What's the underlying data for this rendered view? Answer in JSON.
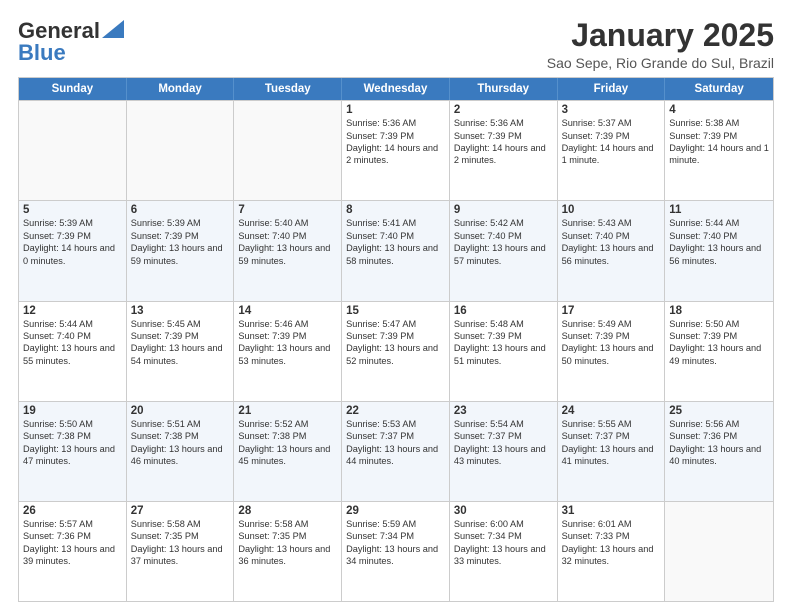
{
  "header": {
    "logo_line1": "General",
    "logo_line2": "Blue",
    "month": "January 2025",
    "location": "Sao Sepe, Rio Grande do Sul, Brazil"
  },
  "weekdays": [
    "Sunday",
    "Monday",
    "Tuesday",
    "Wednesday",
    "Thursday",
    "Friday",
    "Saturday"
  ],
  "rows": [
    [
      {
        "day": "",
        "info": "",
        "empty": true
      },
      {
        "day": "",
        "info": "",
        "empty": true
      },
      {
        "day": "",
        "info": "",
        "empty": true
      },
      {
        "day": "1",
        "info": "Sunrise: 5:36 AM\nSunset: 7:39 PM\nDaylight: 14 hours and 2 minutes."
      },
      {
        "day": "2",
        "info": "Sunrise: 5:36 AM\nSunset: 7:39 PM\nDaylight: 14 hours and 2 minutes."
      },
      {
        "day": "3",
        "info": "Sunrise: 5:37 AM\nSunset: 7:39 PM\nDaylight: 14 hours and 1 minute."
      },
      {
        "day": "4",
        "info": "Sunrise: 5:38 AM\nSunset: 7:39 PM\nDaylight: 14 hours and 1 minute."
      }
    ],
    [
      {
        "day": "5",
        "info": "Sunrise: 5:39 AM\nSunset: 7:39 PM\nDaylight: 14 hours and 0 minutes."
      },
      {
        "day": "6",
        "info": "Sunrise: 5:39 AM\nSunset: 7:39 PM\nDaylight: 13 hours and 59 minutes."
      },
      {
        "day": "7",
        "info": "Sunrise: 5:40 AM\nSunset: 7:40 PM\nDaylight: 13 hours and 59 minutes."
      },
      {
        "day": "8",
        "info": "Sunrise: 5:41 AM\nSunset: 7:40 PM\nDaylight: 13 hours and 58 minutes."
      },
      {
        "day": "9",
        "info": "Sunrise: 5:42 AM\nSunset: 7:40 PM\nDaylight: 13 hours and 57 minutes."
      },
      {
        "day": "10",
        "info": "Sunrise: 5:43 AM\nSunset: 7:40 PM\nDaylight: 13 hours and 56 minutes."
      },
      {
        "day": "11",
        "info": "Sunrise: 5:44 AM\nSunset: 7:40 PM\nDaylight: 13 hours and 56 minutes."
      }
    ],
    [
      {
        "day": "12",
        "info": "Sunrise: 5:44 AM\nSunset: 7:40 PM\nDaylight: 13 hours and 55 minutes."
      },
      {
        "day": "13",
        "info": "Sunrise: 5:45 AM\nSunset: 7:39 PM\nDaylight: 13 hours and 54 minutes."
      },
      {
        "day": "14",
        "info": "Sunrise: 5:46 AM\nSunset: 7:39 PM\nDaylight: 13 hours and 53 minutes."
      },
      {
        "day": "15",
        "info": "Sunrise: 5:47 AM\nSunset: 7:39 PM\nDaylight: 13 hours and 52 minutes."
      },
      {
        "day": "16",
        "info": "Sunrise: 5:48 AM\nSunset: 7:39 PM\nDaylight: 13 hours and 51 minutes."
      },
      {
        "day": "17",
        "info": "Sunrise: 5:49 AM\nSunset: 7:39 PM\nDaylight: 13 hours and 50 minutes."
      },
      {
        "day": "18",
        "info": "Sunrise: 5:50 AM\nSunset: 7:39 PM\nDaylight: 13 hours and 49 minutes."
      }
    ],
    [
      {
        "day": "19",
        "info": "Sunrise: 5:50 AM\nSunset: 7:38 PM\nDaylight: 13 hours and 47 minutes."
      },
      {
        "day": "20",
        "info": "Sunrise: 5:51 AM\nSunset: 7:38 PM\nDaylight: 13 hours and 46 minutes."
      },
      {
        "day": "21",
        "info": "Sunrise: 5:52 AM\nSunset: 7:38 PM\nDaylight: 13 hours and 45 minutes."
      },
      {
        "day": "22",
        "info": "Sunrise: 5:53 AM\nSunset: 7:37 PM\nDaylight: 13 hours and 44 minutes."
      },
      {
        "day": "23",
        "info": "Sunrise: 5:54 AM\nSunset: 7:37 PM\nDaylight: 13 hours and 43 minutes."
      },
      {
        "day": "24",
        "info": "Sunrise: 5:55 AM\nSunset: 7:37 PM\nDaylight: 13 hours and 41 minutes."
      },
      {
        "day": "25",
        "info": "Sunrise: 5:56 AM\nSunset: 7:36 PM\nDaylight: 13 hours and 40 minutes."
      }
    ],
    [
      {
        "day": "26",
        "info": "Sunrise: 5:57 AM\nSunset: 7:36 PM\nDaylight: 13 hours and 39 minutes."
      },
      {
        "day": "27",
        "info": "Sunrise: 5:58 AM\nSunset: 7:35 PM\nDaylight: 13 hours and 37 minutes."
      },
      {
        "day": "28",
        "info": "Sunrise: 5:58 AM\nSunset: 7:35 PM\nDaylight: 13 hours and 36 minutes."
      },
      {
        "day": "29",
        "info": "Sunrise: 5:59 AM\nSunset: 7:34 PM\nDaylight: 13 hours and 34 minutes."
      },
      {
        "day": "30",
        "info": "Sunrise: 6:00 AM\nSunset: 7:34 PM\nDaylight: 13 hours and 33 minutes."
      },
      {
        "day": "31",
        "info": "Sunrise: 6:01 AM\nSunset: 7:33 PM\nDaylight: 13 hours and 32 minutes."
      },
      {
        "day": "",
        "info": "",
        "empty": true
      }
    ]
  ]
}
